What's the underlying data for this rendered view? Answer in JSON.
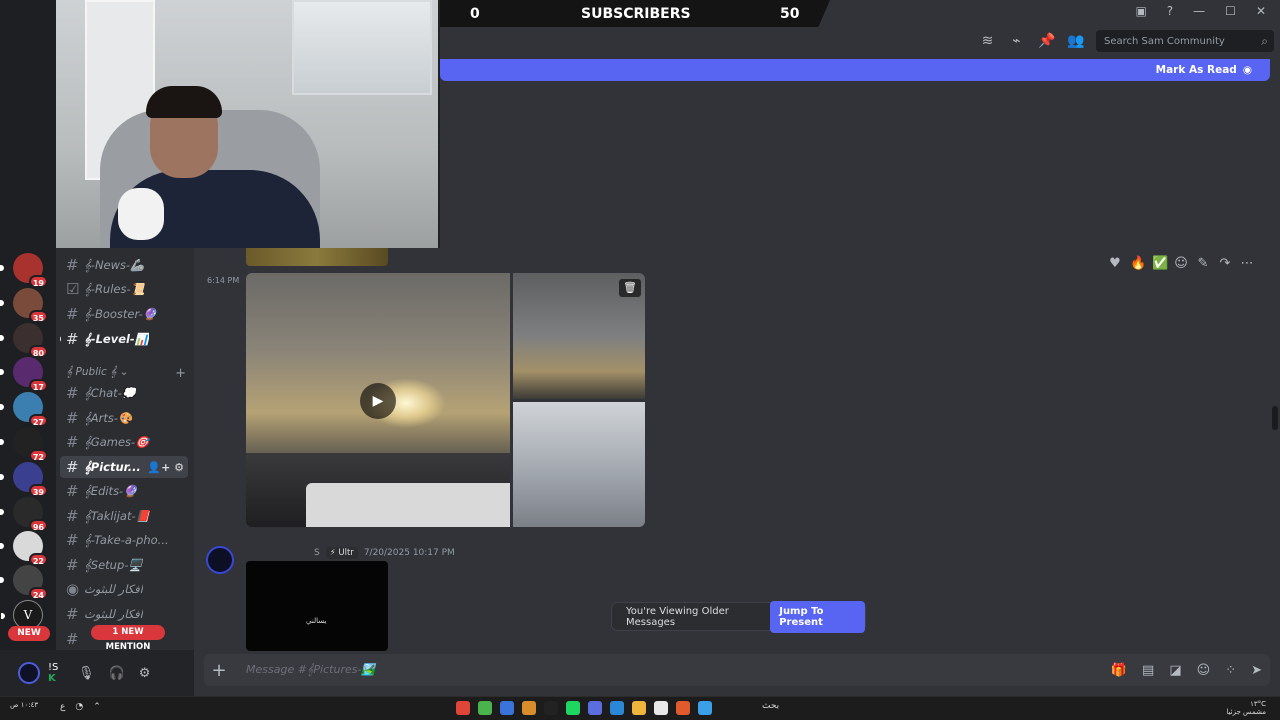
{
  "stream_overlay": {
    "left_count": "0",
    "title": "SUBSCRIBERS",
    "right_count": "50"
  },
  "header": {
    "search_placeholder": "Search Sam Community"
  },
  "banner": {
    "mark_as_read": "Mark As Read"
  },
  "servers": [
    {
      "badge": "19",
      "color": "#a8322d"
    },
    {
      "badge": "35",
      "color": "#7a4b3a"
    },
    {
      "badge": "80",
      "color": "#3b2f2f"
    },
    {
      "badge": "17",
      "color": "#5a2a6e"
    },
    {
      "badge": "27",
      "color": "#3a7fb0"
    },
    {
      "badge": "72",
      "color": "#222222"
    },
    {
      "badge": "39",
      "color": "#3a3f8f"
    },
    {
      "badge": "96",
      "color": "#2a2a2a"
    },
    {
      "badge": "22",
      "color": "#d9d9d9"
    },
    {
      "badge": "24",
      "color": "#444444"
    },
    {
      "badge": "",
      "color": "#1a1a1a"
    }
  ],
  "server_v_label": "V",
  "new_label": "NEW",
  "channels_top": [
    {
      "label": "𝄞-News-🦾",
      "icon": "#"
    },
    {
      "label": "𝄞-Rules-📜",
      "icon": "☑"
    },
    {
      "label": "𝄞-Booster-🔮",
      "icon": "#"
    },
    {
      "label": "𝄞-Level-📊",
      "icon": "#"
    }
  ],
  "category": {
    "label": "𝄞 Public 𝄞 ⌄",
    "add": "+"
  },
  "channels_public": [
    {
      "label": "𝄞Chat-💭",
      "icon": "#"
    },
    {
      "label": "𝄞Arts-🎨",
      "icon": "#"
    },
    {
      "label": "𝄞Games-🎯",
      "icon": "#"
    },
    {
      "label": "𝄞Pictur...",
      "icon": "#"
    },
    {
      "label": "𝄞Edits-🔮",
      "icon": "#"
    },
    {
      "label": "𝄞Taklijat-📕",
      "icon": "#"
    },
    {
      "label": "𝄞-Take-a-pho...",
      "icon": "#"
    },
    {
      "label": "𝄞Setup-🖥️",
      "icon": "#"
    },
    {
      "label": "افكار للبثوث",
      "icon": "◉"
    },
    {
      "label": "افكار للبثوث",
      "icon": "#"
    },
    {
      "label": "",
      "icon": "#"
    }
  ],
  "mention_label": "1 NEW MENTION",
  "user": {
    "name": "!S",
    "status": "K"
  },
  "message1": {
    "time": "6:14 PM"
  },
  "message2": {
    "role": "⚡ Ultr",
    "timestamp": "7/20/2025 10:17 PM",
    "author_initial": "S",
    "image_caption": "يسالني"
  },
  "older_bar": {
    "text": "You're Viewing Older Messages",
    "jump": "Jump To Present"
  },
  "composer": {
    "placeholder": "Message #𝄞Pictures-🏞️"
  },
  "taskbar": {
    "left_text": "١٠:٤٣ ص",
    "search": "بحث",
    "right_time": "١٣°C",
    "right_date": "مشمس جزئيا"
  }
}
